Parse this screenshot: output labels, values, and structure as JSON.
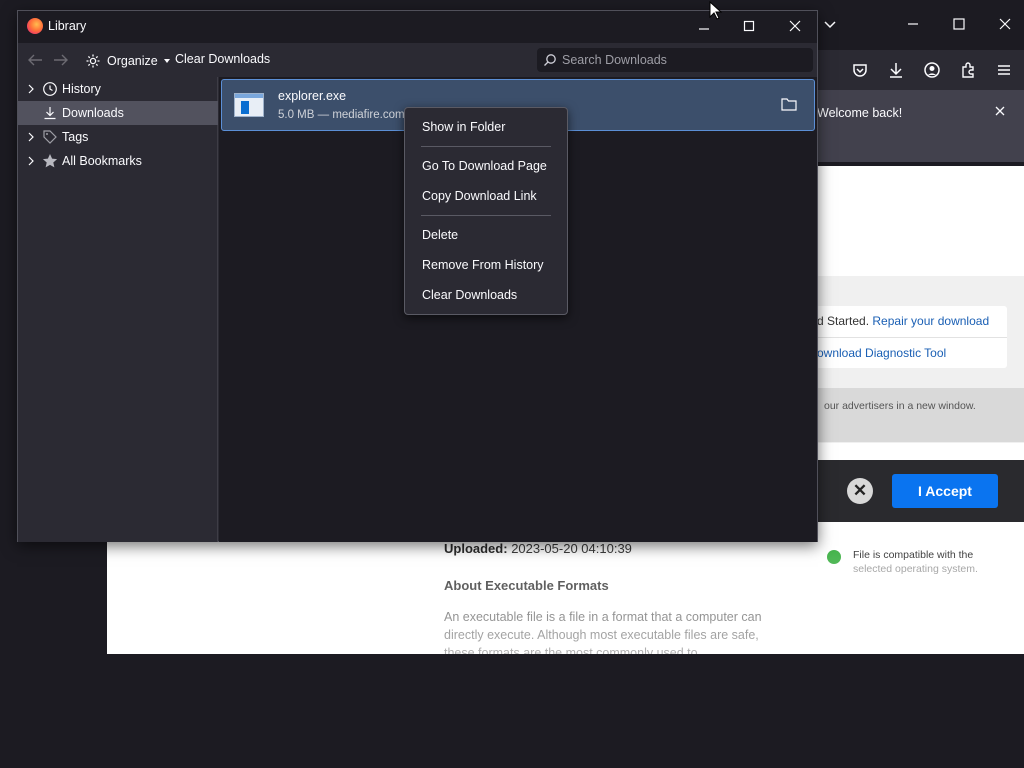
{
  "background_browser": {
    "notification": {
      "message": "Welcome back!"
    },
    "repair": {
      "prefix": "d Started. ",
      "repair_link": "Repair your download",
      "tool_link": "ownload Diagnostic Tool"
    },
    "ad_notice": "our advertisers in a new window.",
    "consent": {
      "close_symbol": "✕",
      "accept_label": "I Accept"
    },
    "file_info": {
      "uploaded_label": "Uploaded:",
      "uploaded_value": "2023-05-20 04:10:39",
      "about_heading": "About Executable Formats",
      "about_text": "An executable file is a file in a format that a computer can directly execute. Although most executable files are safe, these formats are the most commonly used to"
    },
    "compat": {
      "line1": "File is compatible with the",
      "line2": "selected operating system."
    }
  },
  "library": {
    "title": "Library",
    "toolbar": {
      "organize_label": "Organize",
      "clear_downloads_label": "Clear Downloads",
      "search_placeholder": "Search Downloads"
    },
    "sidebar": {
      "items": [
        {
          "label": "History",
          "icon": "clock-icon",
          "expandable": true,
          "selected": false
        },
        {
          "label": "Downloads",
          "icon": "download-icon",
          "expandable": false,
          "selected": true
        },
        {
          "label": "Tags",
          "icon": "tag-icon",
          "expandable": true,
          "selected": false
        },
        {
          "label": "All Bookmarks",
          "icon": "star-icon",
          "expandable": true,
          "selected": false
        }
      ]
    },
    "downloads": [
      {
        "name": "explorer.exe",
        "meta": "5.0 MB — mediafire.com",
        "icon": "executable-file-icon"
      }
    ]
  },
  "context_menu": {
    "items": [
      {
        "label": "Show in Folder"
      },
      {
        "label": "Go To Download Page"
      },
      {
        "label": "Copy Download Link"
      },
      {
        "label": "Delete"
      },
      {
        "label": "Remove From History"
      },
      {
        "label": "Clear Downloads"
      }
    ]
  },
  "colors": {
    "dark_bg": "#1c1b22",
    "panel_bg": "#2b2a33",
    "selected_row": "#3c4f6b",
    "accept_blue": "#0a74f0"
  }
}
